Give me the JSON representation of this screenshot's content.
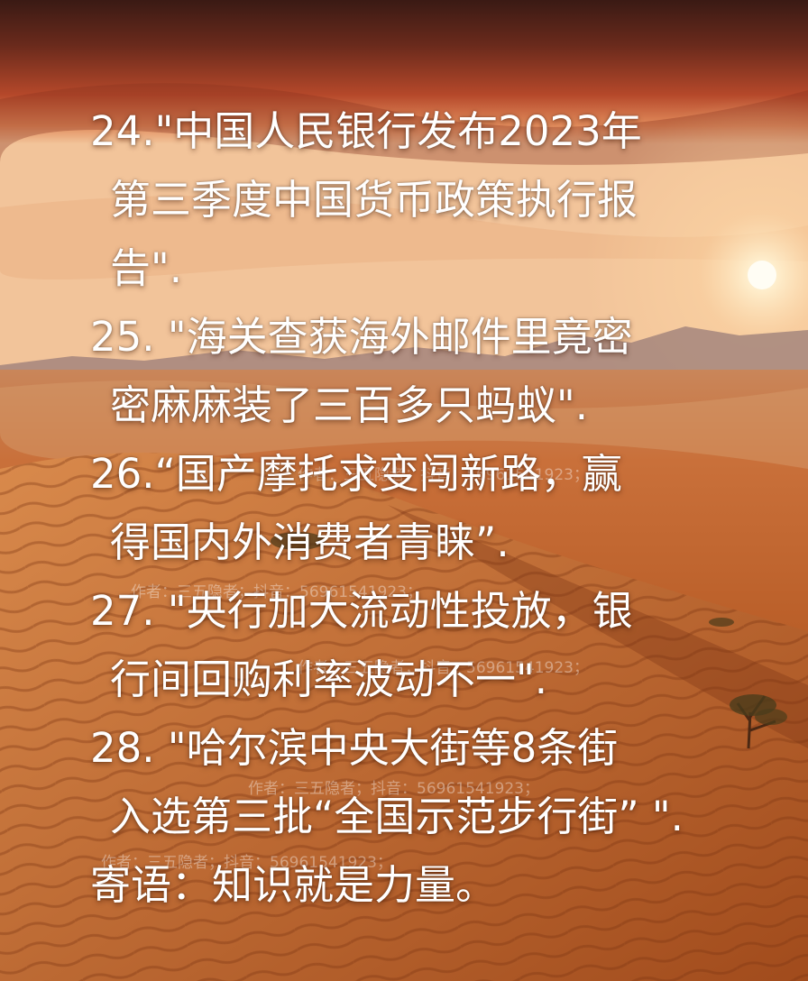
{
  "items": [
    {
      "lines": [
        "24.\"中国人民银行发布2023年",
        "第三季度中国货币政策执行报",
        "告\"."
      ]
    },
    {
      "lines": [
        "25. \"海关查获海外邮件里竟密",
        "密麻麻装了三百多只蚂蚁\"."
      ]
    },
    {
      "lines": [
        "26.“国产摩托求变闯新路，赢",
        "得国内外消费者青睐”."
      ]
    },
    {
      "lines": [
        "27. \"央行加大流动性投放，银",
        "行间回购利率波动不一\"."
      ]
    },
    {
      "lines": [
        "28. \"哈尔滨中央大街等8条街",
        "入选第三批“全国示范步行街” \"."
      ]
    }
  ],
  "motto": "寄语：知识就是力量。",
  "watermark": "作者：三五隐者；抖音：56961541923；",
  "colors": {
    "text": "#ffffff",
    "sky_top": "#3a1a14",
    "sun": "#fff4d8",
    "sand": "#c46a2e"
  }
}
